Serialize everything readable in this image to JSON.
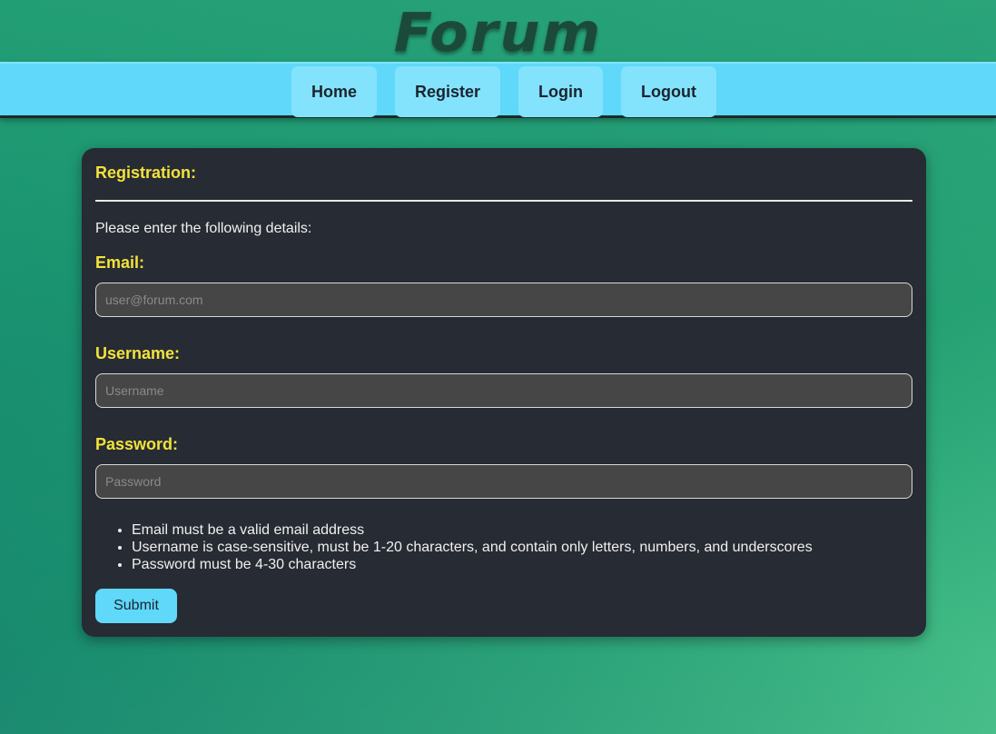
{
  "header": {
    "logo_text": "Forum"
  },
  "nav": {
    "items": [
      {
        "label": "Home"
      },
      {
        "label": "Register"
      },
      {
        "label": "Login"
      },
      {
        "label": "Logout"
      }
    ]
  },
  "form": {
    "title": "Registration:",
    "intro": "Please enter the following details:",
    "email": {
      "label": "Email:",
      "placeholder": "user@forum.com",
      "value": ""
    },
    "username": {
      "label": "Username:",
      "placeholder": "Username",
      "value": ""
    },
    "password": {
      "label": "Password:",
      "placeholder": "Password",
      "value": ""
    },
    "rules": [
      "Email must be a valid email address",
      "Username is case-sensitive, must be 1-20 characters, and contain only letters, numbers, and underscores",
      "Password must be 4-30 characters"
    ],
    "submit_label": "Submit"
  },
  "colors": {
    "accent_yellow": "#f2e23b",
    "nav_blue": "#5fd8fa",
    "card_bg": "#272b33"
  }
}
